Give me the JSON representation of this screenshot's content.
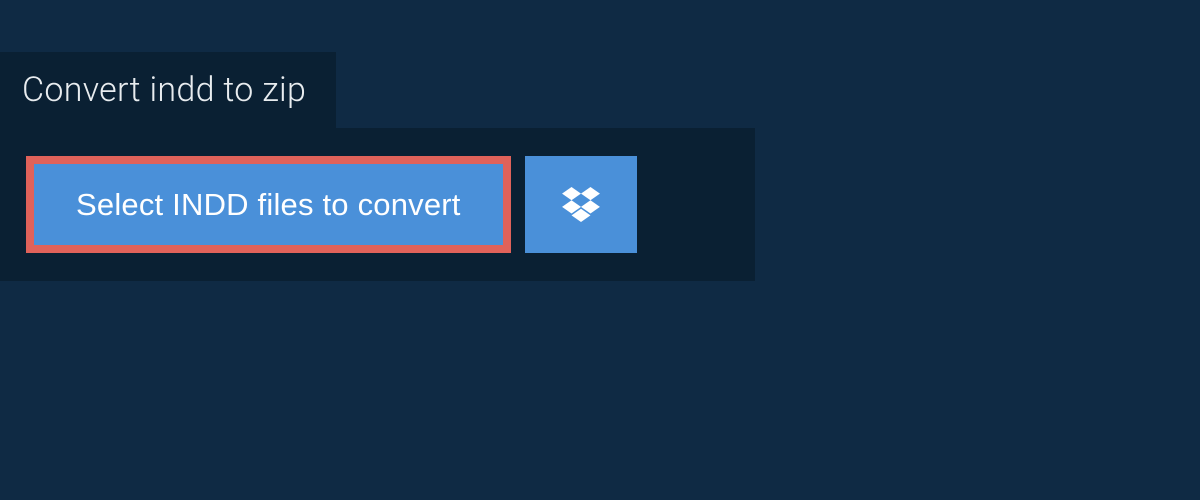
{
  "header": {
    "title": "Convert indd to zip"
  },
  "actions": {
    "select_label": "Select INDD files to convert"
  },
  "colors": {
    "page_bg": "#0f2a44",
    "panel_bg": "#0a2033",
    "button_bg": "#4a90d9",
    "highlight_border": "#e0625a",
    "text_light": "#e8ecef"
  }
}
